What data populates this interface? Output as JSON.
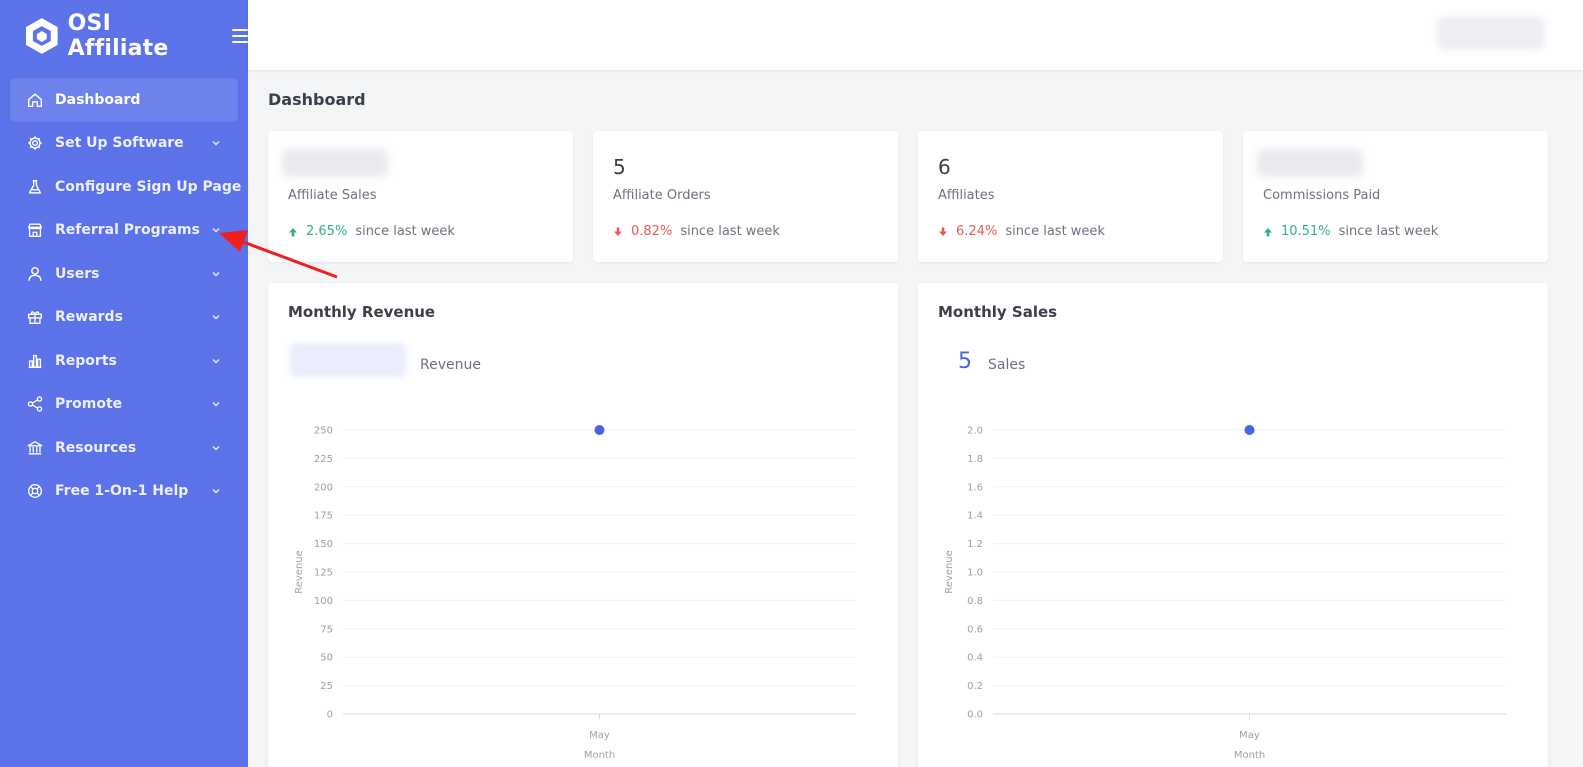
{
  "brand": {
    "name": "OSI Affiliate"
  },
  "sidebar": {
    "items": [
      {
        "label": "Dashboard",
        "icon": "home-icon",
        "active": true,
        "has_submenu": false
      },
      {
        "label": "Set Up Software",
        "icon": "gear-icon",
        "active": false,
        "has_submenu": true
      },
      {
        "label": "Configure Sign Up Page",
        "icon": "flask-icon",
        "active": false,
        "has_submenu": false
      },
      {
        "label": "Referral Programs",
        "icon": "store-icon",
        "active": false,
        "has_submenu": true
      },
      {
        "label": "Users",
        "icon": "user-icon",
        "active": false,
        "has_submenu": true
      },
      {
        "label": "Rewards",
        "icon": "gift-icon",
        "active": false,
        "has_submenu": true
      },
      {
        "label": "Reports",
        "icon": "bar-chart-icon",
        "active": false,
        "has_submenu": true
      },
      {
        "label": "Promote",
        "icon": "share-icon",
        "active": false,
        "has_submenu": true
      },
      {
        "label": "Resources",
        "icon": "bank-icon",
        "active": false,
        "has_submenu": true
      },
      {
        "label": "Free 1-On-1 Help",
        "icon": "lifebuoy-icon",
        "active": false,
        "has_submenu": true
      }
    ]
  },
  "page": {
    "title": "Dashboard"
  },
  "stats": [
    {
      "value": "",
      "label": "Affiliate Sales",
      "change": "2.65%",
      "direction": "up",
      "suffix": "since last week",
      "blurred": true
    },
    {
      "value": "5",
      "label": "Affiliate Orders",
      "change": "0.82%",
      "direction": "down",
      "suffix": "since last week",
      "blurred": false
    },
    {
      "value": "6",
      "label": "Affiliates",
      "change": "6.24%",
      "direction": "down",
      "suffix": "since last week",
      "blurred": false
    },
    {
      "value": "",
      "label": "Commissions Paid",
      "change": "10.51%",
      "direction": "up",
      "suffix": "since last week",
      "blurred": true
    }
  ],
  "colors": {
    "sidebar": "#5b72e8",
    "accent": "#4a63e3",
    "up": "#2fb380",
    "down": "#e65a5a"
  },
  "revenue_panel": {
    "title": "Monthly Revenue",
    "total": "",
    "caption": "Revenue"
  },
  "sales_panel": {
    "title": "Monthly Sales",
    "total": "5",
    "caption": "Sales"
  },
  "chart_data": [
    {
      "type": "scatter",
      "title": "Monthly Revenue",
      "xlabel": "Month",
      "ylabel": "Revenue",
      "categories": [
        "May"
      ],
      "values": [
        250
      ],
      "ylim": [
        0,
        250
      ],
      "yticks": [
        "0",
        "25",
        "50",
        "75",
        "100",
        "125",
        "150",
        "175",
        "200",
        "225",
        "250"
      ],
      "color": "#4a63e3",
      "grid": true
    },
    {
      "type": "scatter",
      "title": "Monthly Sales",
      "xlabel": "Month",
      "ylabel": "Revenue",
      "categories": [
        "May"
      ],
      "values": [
        2.0
      ],
      "ylim": [
        0,
        2.0
      ],
      "yticks": [
        "0.0",
        "0.2",
        "0.4",
        "0.6",
        "0.8",
        "1.0",
        "1.2",
        "1.4",
        "1.6",
        "1.8",
        "2.0"
      ],
      "color": "#4a63e3",
      "grid": true
    }
  ]
}
